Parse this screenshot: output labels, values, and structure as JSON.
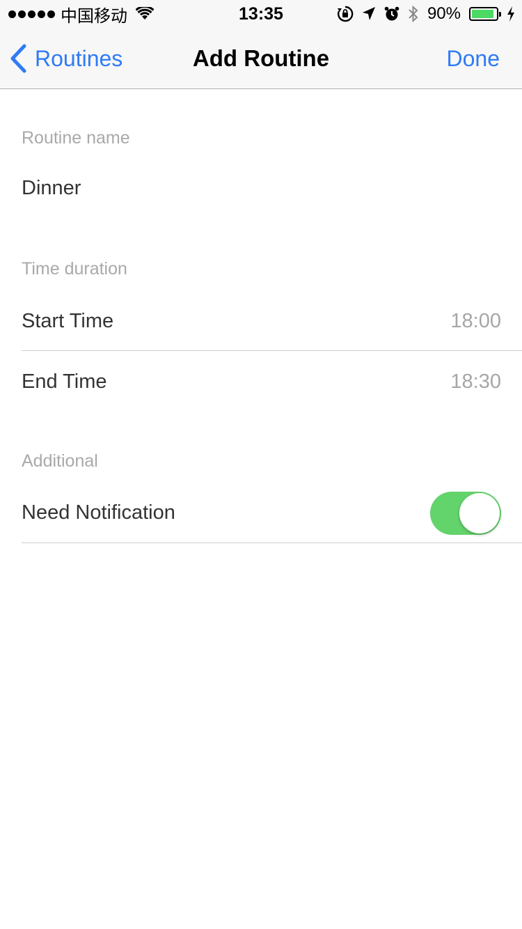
{
  "status_bar": {
    "carrier": "中国移动",
    "time": "13:35",
    "battery_percent": "90%",
    "battery_level": 0.9,
    "icons": [
      "signal-dots-icon",
      "wifi-icon",
      "rotation-lock-icon",
      "location-icon",
      "alarm-icon",
      "bluetooth-icon",
      "battery-icon",
      "charging-icon"
    ]
  },
  "nav": {
    "back_label": "Routines",
    "title": "Add Routine",
    "done_label": "Done"
  },
  "sections": {
    "name": {
      "header": "Routine name",
      "value": "Dinner"
    },
    "time": {
      "header": "Time duration",
      "start_label": "Start Time",
      "start_value": "18:00",
      "end_label": "End Time",
      "end_value": "18:30"
    },
    "additional": {
      "header": "Additional",
      "notification_label": "Need Notification",
      "notification_on": true
    }
  },
  "colors": {
    "accent": "#2f7bf5",
    "toggle_on": "#63d36b",
    "battery_fill": "#4cd964"
  }
}
